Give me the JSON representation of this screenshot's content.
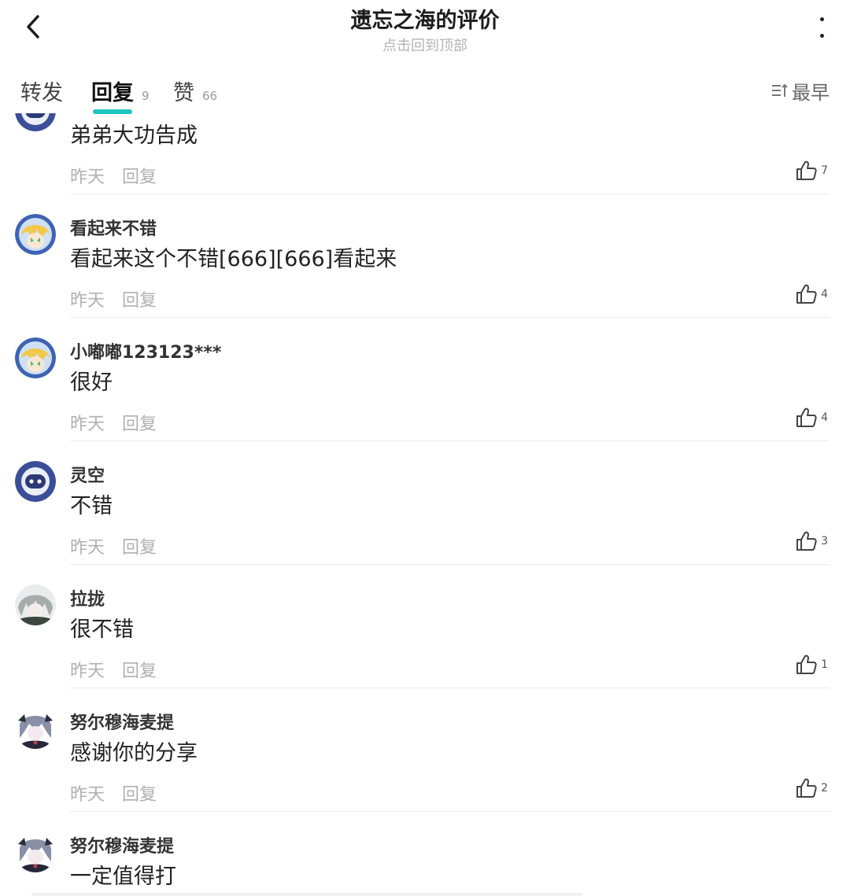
{
  "header": {
    "title": "遗忘之海的评价",
    "subtitle": "点击回到顶部"
  },
  "tabs": [
    {
      "label": "转发",
      "count": ""
    },
    {
      "label": "回复",
      "count": "9"
    },
    {
      "label": "赞",
      "count": "66"
    }
  ],
  "sort_label": "最早",
  "comments": [
    {
      "username": "",
      "content": "弟弟大功告成",
      "time": "昨天",
      "reply": "回复",
      "likes": "7",
      "avatar": "robot"
    },
    {
      "username": "看起来不错",
      "content": "看起来这个不错[666][666]看起来",
      "time": "昨天",
      "reply": "回复",
      "likes": "4",
      "avatar": "anime-yellow"
    },
    {
      "username": "小嘟嘟123123***",
      "content": "很好",
      "time": "昨天",
      "reply": "回复",
      "likes": "4",
      "avatar": "anime-yellow"
    },
    {
      "username": "灵空",
      "content": "不错",
      "time": "昨天",
      "reply": "回复",
      "likes": "3",
      "avatar": "robot"
    },
    {
      "username": "拉拢",
      "content": "很不错",
      "time": "昨天",
      "reply": "回复",
      "likes": "1",
      "avatar": "anime-grey"
    },
    {
      "username": "努尔穆海麦提",
      "content": "感谢你的分享",
      "time": "昨天",
      "reply": "回复",
      "likes": "2",
      "avatar": "anime-dark"
    },
    {
      "username": "努尔穆海麦提",
      "content": "一定值得打",
      "time": "",
      "reply": "",
      "likes": "",
      "avatar": "anime-dark"
    }
  ]
}
